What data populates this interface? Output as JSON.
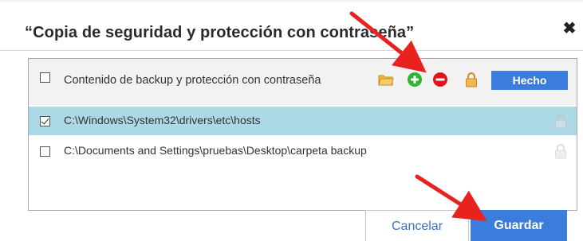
{
  "dialog": {
    "title": "“Copia de seguridad y protección con contraseña”",
    "close_symbol": "✖"
  },
  "panel": {
    "header": {
      "label": "Contenido de backup y protección con contraseña",
      "checked": false,
      "toolbar": {
        "icons": [
          "folder-open-icon",
          "add-circle-icon",
          "remove-circle-icon",
          "lock-icon"
        ],
        "done_label": "Hecho"
      }
    },
    "rows": [
      {
        "path": "C:\\Windows\\System32\\drivers\\etc\\hosts",
        "checked": true,
        "selected": true,
        "icon": "lock-icon"
      },
      {
        "path": "C:\\Documents and Settings\\pruebas\\Desktop\\carpeta backup",
        "checked": false,
        "selected": false,
        "icon": "lock-icon"
      }
    ]
  },
  "footer": {
    "cancel_label": "Cancelar",
    "save_label": "Guardar"
  },
  "colors": {
    "accent": "#3b7ddd",
    "selected_row": "#add8e6",
    "add": "#2fb52f",
    "remove": "#e0141c",
    "folder": "#f2b84b",
    "lock": "#e8a91c",
    "annotation_arrow": "#e8231f"
  }
}
